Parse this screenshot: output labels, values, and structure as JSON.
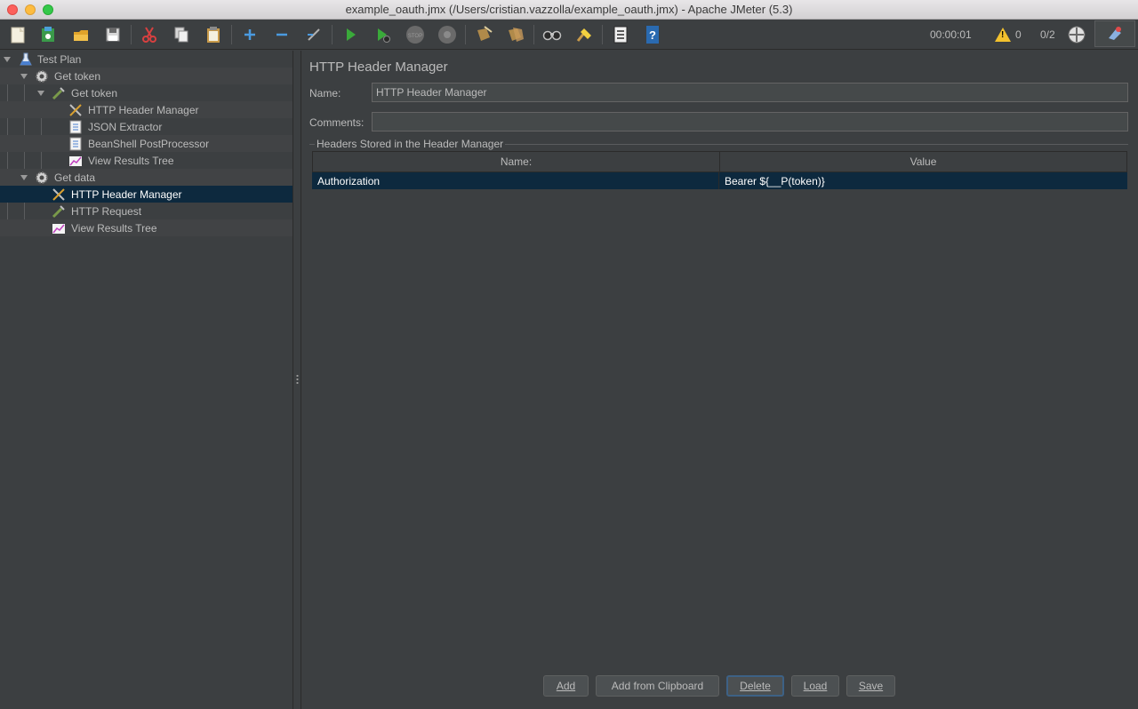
{
  "window": {
    "title": "example_oauth.jmx (/Users/cristian.vazzolla/example_oauth.jmx) - Apache JMeter (5.3)"
  },
  "toolbar": {
    "icons": [
      "new-icon",
      "templates-icon",
      "open-icon",
      "save-icon",
      "cut-icon",
      "copy-icon",
      "paste-icon",
      "expand-icon",
      "collapse-icon",
      "toggle-icon",
      "start-icon",
      "start-no-pauses-icon",
      "stop-icon",
      "shutdown-icon",
      "clear-icon",
      "clear-all-icon",
      "search-icon",
      "reset-search-icon",
      "function-helper-icon",
      "help-icon"
    ],
    "elapsed_time": "00:00:01",
    "warning_count": "0",
    "thread_count": "0/2"
  },
  "tree": {
    "items": [
      {
        "label": "Test Plan",
        "icon": "flask-icon"
      },
      {
        "label": "Get token",
        "icon": "gear-icon"
      },
      {
        "label": "Get token",
        "icon": "pipette-icon"
      },
      {
        "label": "HTTP Header Manager",
        "icon": "tools-icon"
      },
      {
        "label": "JSON Extractor",
        "icon": "document-icon"
      },
      {
        "label": "BeanShell PostProcessor",
        "icon": "document-icon"
      },
      {
        "label": "View Results Tree",
        "icon": "graph-icon"
      },
      {
        "label": "Get data",
        "icon": "gear-icon"
      },
      {
        "label": "HTTP Header Manager",
        "icon": "tools-icon"
      },
      {
        "label": "HTTP Request",
        "icon": "pipette-icon"
      },
      {
        "label": "View Results Tree",
        "icon": "graph-icon"
      }
    ],
    "selected_index": 8
  },
  "editor": {
    "title": "HTTP Header Manager",
    "name_label": "Name:",
    "name_value": "HTTP Header Manager",
    "comments_label": "Comments:",
    "comments_value": "",
    "group_title": "Headers Stored in the Header Manager",
    "table": {
      "headers": [
        "Name:",
        "Value"
      ],
      "rows": [
        {
          "name": "Authorization",
          "value": "Bearer ${__P(token)}"
        }
      ]
    },
    "buttons": {
      "add": "Add",
      "add_from_clipboard": "Add from Clipboard",
      "delete": "Delete",
      "load": "Load",
      "save": "Save"
    }
  },
  "colors": {
    "background": "#3c3f41",
    "selection": "#0d293e",
    "text": "#bbbbbb"
  }
}
